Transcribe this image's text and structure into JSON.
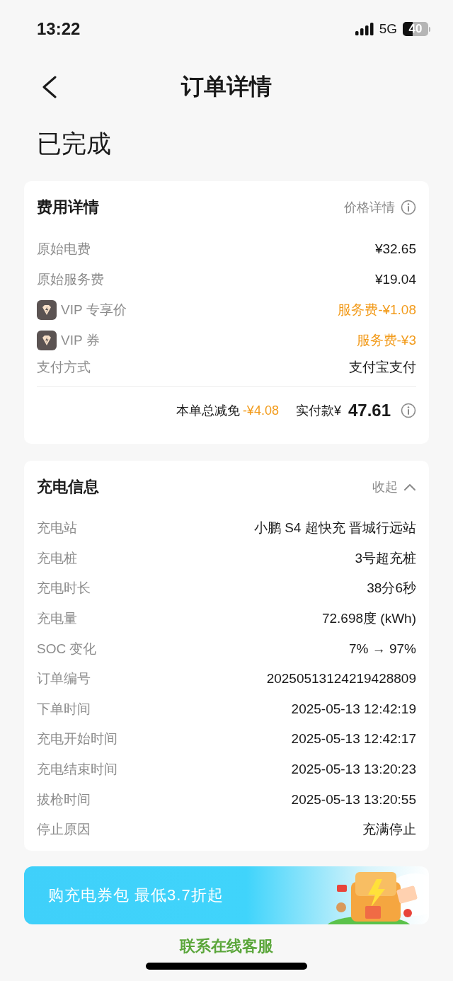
{
  "status_bar": {
    "time": "13:22",
    "network": "5G",
    "battery": "40"
  },
  "nav": {
    "title": "订单详情"
  },
  "order_status": "已完成",
  "fee_card": {
    "title": "费用详情",
    "link": "价格详情",
    "rows": [
      {
        "kind": "plain",
        "label": "原始电费",
        "value": "¥32.65"
      },
      {
        "kind": "plain",
        "label": "原始服务费",
        "value": "¥19.04"
      },
      {
        "kind": "vip",
        "label": "VIP 专享价",
        "value": "服务费-¥1.08"
      },
      {
        "kind": "vip",
        "label": "VIP 券",
        "value": "服务费-¥3"
      },
      {
        "kind": "plain",
        "label": "支付方式",
        "value": "支付宝支付"
      }
    ],
    "discount_label": "本单总减免",
    "discount_value": "-¥4.08",
    "paid_label": "实付款¥",
    "paid_value": "47.61"
  },
  "charge_card": {
    "title": "充电信息",
    "toggle": "收起",
    "expanded": true,
    "rows": [
      {
        "label": "充电站",
        "value": "小鹏 S4 超快充 晋城行远站"
      },
      {
        "label": "充电桩",
        "value": "3号超充桩"
      },
      {
        "label": "充电时长",
        "value": "38分6秒"
      },
      {
        "label": "充电量",
        "value": "72.698度 (kWh)"
      },
      {
        "label": "SOC 变化",
        "value": "7% → 97%"
      },
      {
        "label": "订单编号",
        "value": "20250513124219428809"
      },
      {
        "label": "下单时间",
        "value": "2025-05-13 12:42:19"
      },
      {
        "label": "充电开始时间",
        "value": "2025-05-13 12:42:17"
      },
      {
        "label": "充电结束时间",
        "value": "2025-05-13 13:20:23"
      },
      {
        "label": "拔枪时间",
        "value": "2025-05-13 13:20:55"
      },
      {
        "label": "停止原因",
        "value": "充满停止"
      }
    ]
  },
  "banner": {
    "text": "购充电券包 最低3.7折起"
  },
  "contact_link": "联系在线客服"
}
